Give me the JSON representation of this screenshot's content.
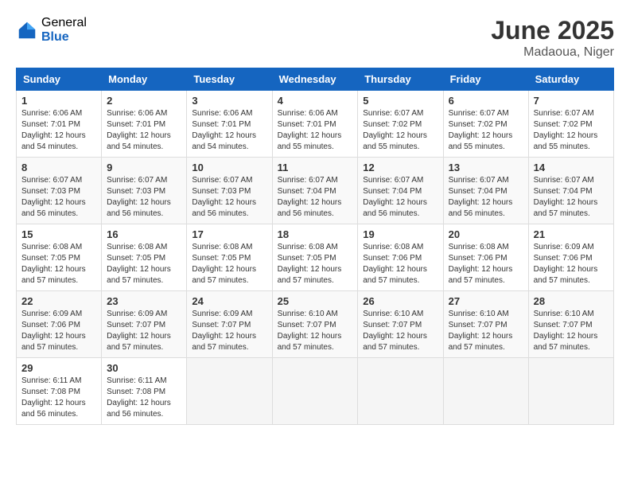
{
  "header": {
    "logo_general": "General",
    "logo_blue": "Blue",
    "month_title": "June 2025",
    "location": "Madaoua, Niger"
  },
  "weekdays": [
    "Sunday",
    "Monday",
    "Tuesday",
    "Wednesday",
    "Thursday",
    "Friday",
    "Saturday"
  ],
  "weeks": [
    [
      {
        "day": "1",
        "sunrise": "6:06 AM",
        "sunset": "7:01 PM",
        "daylight": "12 hours and 54 minutes."
      },
      {
        "day": "2",
        "sunrise": "6:06 AM",
        "sunset": "7:01 PM",
        "daylight": "12 hours and 54 minutes."
      },
      {
        "day": "3",
        "sunrise": "6:06 AM",
        "sunset": "7:01 PM",
        "daylight": "12 hours and 54 minutes."
      },
      {
        "day": "4",
        "sunrise": "6:06 AM",
        "sunset": "7:01 PM",
        "daylight": "12 hours and 55 minutes."
      },
      {
        "day": "5",
        "sunrise": "6:07 AM",
        "sunset": "7:02 PM",
        "daylight": "12 hours and 55 minutes."
      },
      {
        "day": "6",
        "sunrise": "6:07 AM",
        "sunset": "7:02 PM",
        "daylight": "12 hours and 55 minutes."
      },
      {
        "day": "7",
        "sunrise": "6:07 AM",
        "sunset": "7:02 PM",
        "daylight": "12 hours and 55 minutes."
      }
    ],
    [
      {
        "day": "8",
        "sunrise": "6:07 AM",
        "sunset": "7:03 PM",
        "daylight": "12 hours and 56 minutes."
      },
      {
        "day": "9",
        "sunrise": "6:07 AM",
        "sunset": "7:03 PM",
        "daylight": "12 hours and 56 minutes."
      },
      {
        "day": "10",
        "sunrise": "6:07 AM",
        "sunset": "7:03 PM",
        "daylight": "12 hours and 56 minutes."
      },
      {
        "day": "11",
        "sunrise": "6:07 AM",
        "sunset": "7:04 PM",
        "daylight": "12 hours and 56 minutes."
      },
      {
        "day": "12",
        "sunrise": "6:07 AM",
        "sunset": "7:04 PM",
        "daylight": "12 hours and 56 minutes."
      },
      {
        "day": "13",
        "sunrise": "6:07 AM",
        "sunset": "7:04 PM",
        "daylight": "12 hours and 56 minutes."
      },
      {
        "day": "14",
        "sunrise": "6:07 AM",
        "sunset": "7:04 PM",
        "daylight": "12 hours and 57 minutes."
      }
    ],
    [
      {
        "day": "15",
        "sunrise": "6:08 AM",
        "sunset": "7:05 PM",
        "daylight": "12 hours and 57 minutes."
      },
      {
        "day": "16",
        "sunrise": "6:08 AM",
        "sunset": "7:05 PM",
        "daylight": "12 hours and 57 minutes."
      },
      {
        "day": "17",
        "sunrise": "6:08 AM",
        "sunset": "7:05 PM",
        "daylight": "12 hours and 57 minutes."
      },
      {
        "day": "18",
        "sunrise": "6:08 AM",
        "sunset": "7:05 PM",
        "daylight": "12 hours and 57 minutes."
      },
      {
        "day": "19",
        "sunrise": "6:08 AM",
        "sunset": "7:06 PM",
        "daylight": "12 hours and 57 minutes."
      },
      {
        "day": "20",
        "sunrise": "6:08 AM",
        "sunset": "7:06 PM",
        "daylight": "12 hours and 57 minutes."
      },
      {
        "day": "21",
        "sunrise": "6:09 AM",
        "sunset": "7:06 PM",
        "daylight": "12 hours and 57 minutes."
      }
    ],
    [
      {
        "day": "22",
        "sunrise": "6:09 AM",
        "sunset": "7:06 PM",
        "daylight": "12 hours and 57 minutes."
      },
      {
        "day": "23",
        "sunrise": "6:09 AM",
        "sunset": "7:07 PM",
        "daylight": "12 hours and 57 minutes."
      },
      {
        "day": "24",
        "sunrise": "6:09 AM",
        "sunset": "7:07 PM",
        "daylight": "12 hours and 57 minutes."
      },
      {
        "day": "25",
        "sunrise": "6:10 AM",
        "sunset": "7:07 PM",
        "daylight": "12 hours and 57 minutes."
      },
      {
        "day": "26",
        "sunrise": "6:10 AM",
        "sunset": "7:07 PM",
        "daylight": "12 hours and 57 minutes."
      },
      {
        "day": "27",
        "sunrise": "6:10 AM",
        "sunset": "7:07 PM",
        "daylight": "12 hours and 57 minutes."
      },
      {
        "day": "28",
        "sunrise": "6:10 AM",
        "sunset": "7:07 PM",
        "daylight": "12 hours and 57 minutes."
      }
    ],
    [
      {
        "day": "29",
        "sunrise": "6:11 AM",
        "sunset": "7:08 PM",
        "daylight": "12 hours and 56 minutes."
      },
      {
        "day": "30",
        "sunrise": "6:11 AM",
        "sunset": "7:08 PM",
        "daylight": "12 hours and 56 minutes."
      },
      null,
      null,
      null,
      null,
      null
    ]
  ]
}
